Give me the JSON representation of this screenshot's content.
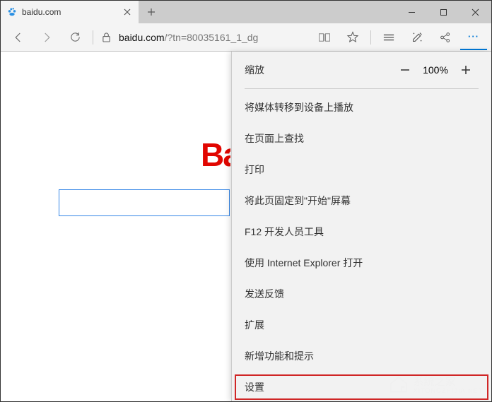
{
  "tab": {
    "title": "baidu.com"
  },
  "address": {
    "host": "baidu.com",
    "path": "/?tn=80035161_1_dg"
  },
  "menu": {
    "zoom_label": "缩放",
    "zoom_value": "100%",
    "items": [
      "将媒体转移到设备上播放",
      "在页面上查找",
      "打印",
      "将此页固定到\"开始\"屏幕",
      "F12 开发人员工具",
      "使用 Internet Explorer 打开",
      "发送反馈",
      "扩展",
      "新增功能和提示",
      "设置"
    ],
    "highlighted_index": 9
  },
  "page": {
    "logo_fragment": "Ba"
  },
  "watermark": {
    "name": "系统之家",
    "url": "XITONGZHIJIA.NET"
  }
}
